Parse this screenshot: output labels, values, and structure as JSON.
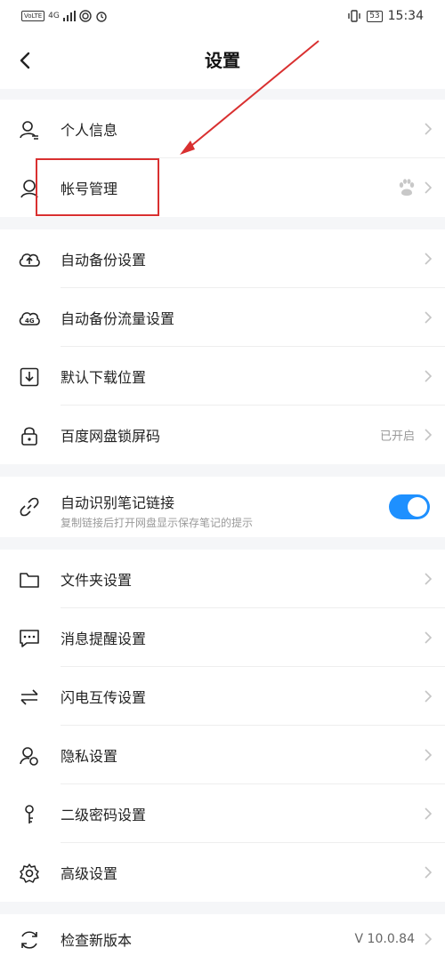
{
  "status_bar": {
    "network": "4G",
    "volte": "VoLTE",
    "battery": "53",
    "time": "15:34"
  },
  "header": {
    "title": "设置"
  },
  "settings": {
    "personal_info": "个人信息",
    "account_management": "帐号管理",
    "auto_backup": "自动备份设置",
    "auto_backup_traffic": "自动备份流量设置",
    "default_download": "默认下载位置",
    "lock_screen_code": "百度网盘锁屏码",
    "lock_screen_status": "已开启",
    "auto_link_title": "自动识别笔记链接",
    "auto_link_subtitle": "复制链接后打开网盘显示保存笔记的提示",
    "auto_link_enabled": true,
    "folder_settings": "文件夹设置",
    "message_reminder": "消息提醒设置",
    "flash_transfer": "闪电互传设置",
    "privacy": "隐私设置",
    "secondary_password": "二级密码设置",
    "advanced": "高级设置",
    "check_update": "检查新版本",
    "version": "V 10.0.84"
  },
  "colors": {
    "accent": "#1e90ff",
    "annotation": "#d93030",
    "divider": "#eeeeee"
  }
}
